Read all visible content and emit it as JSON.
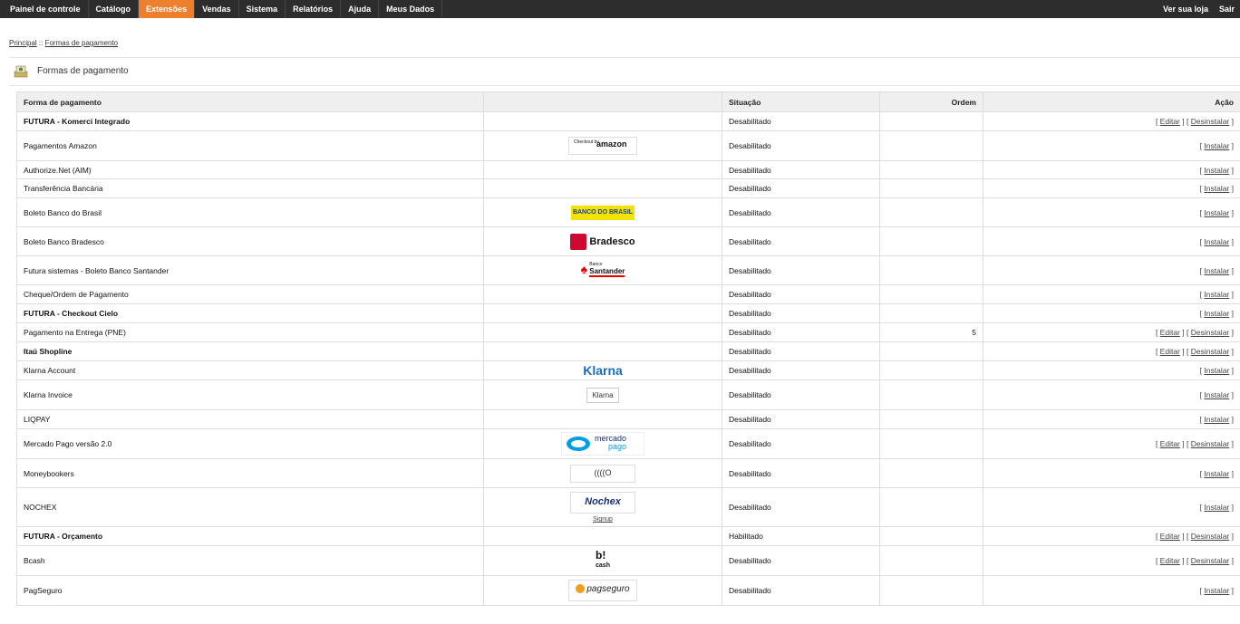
{
  "nav": {
    "items": [
      {
        "label": "Painel de controle",
        "active": false
      },
      {
        "label": "Catálogo",
        "active": false
      },
      {
        "label": "Extensões",
        "active": true
      },
      {
        "label": "Vendas",
        "active": false
      },
      {
        "label": "Sistema",
        "active": false
      },
      {
        "label": "Relatórios",
        "active": false
      },
      {
        "label": "Ajuda",
        "active": false
      },
      {
        "label": "Meus Dados",
        "active": false
      }
    ],
    "store_link": "Ver sua loja",
    "logout": "Sair"
  },
  "breadcrumb": {
    "home": "Principal",
    "separator": " :: ",
    "current": "Formas de pagamento"
  },
  "heading": {
    "title": "Formas de pagamento"
  },
  "table": {
    "headers": {
      "name": "Forma de pagamento",
      "logo": "",
      "status": "Situação",
      "order": "Ordem",
      "action": "Ação"
    },
    "edit_label": "Editar",
    "uninstall_label": "Desinstalar",
    "install_label": "Instalar",
    "rows": [
      {
        "name": "FUTURA - Komerci Integrado",
        "style": "bold",
        "logo": "",
        "status": "Desabilitado",
        "order": "",
        "actions": [
          "edit",
          "uninstall"
        ]
      },
      {
        "name": "Pagamentos Amazon",
        "style": "",
        "logo": "amazon",
        "status": "Desabilitado",
        "order": "",
        "actions": [
          "install"
        ]
      },
      {
        "name": "Authorize.Net (AIM)",
        "style": "",
        "logo": "",
        "status": "Desabilitado",
        "order": "",
        "actions": [
          "install"
        ]
      },
      {
        "name": "Transferência Bancária",
        "style": "",
        "logo": "",
        "status": "Desabilitado",
        "order": "",
        "actions": [
          "install"
        ]
      },
      {
        "name": "Boleto Banco do Brasil",
        "style": "",
        "logo": "bb",
        "status": "Desabilitado",
        "order": "",
        "actions": [
          "install"
        ]
      },
      {
        "name": "Boleto Banco Bradesco",
        "style": "",
        "logo": "bradesco",
        "status": "Desabilitado",
        "order": "",
        "actions": [
          "install"
        ]
      },
      {
        "name": "Futura sistemas - Boleto Banco Santander",
        "style": "",
        "logo": "santander",
        "status": "Desabilitado",
        "order": "",
        "actions": [
          "install"
        ]
      },
      {
        "name": "Cheque/Ordem de Pagamento",
        "style": "",
        "logo": "",
        "status": "Desabilitado",
        "order": "",
        "actions": [
          "install"
        ]
      },
      {
        "name": "FUTURA - Checkout Cielo",
        "style": "bold",
        "logo": "",
        "status": "Desabilitado",
        "order": "",
        "actions": [
          "install"
        ]
      },
      {
        "name": "Pagamento na Entrega (PNE)",
        "style": "",
        "logo": "",
        "status": "Desabilitado",
        "order": "5",
        "actions": [
          "edit",
          "uninstall"
        ]
      },
      {
        "name": "Itaú Shopline",
        "style": "blue",
        "logo": "",
        "status": "Desabilitado",
        "order": "",
        "actions": [
          "edit",
          "uninstall"
        ]
      },
      {
        "name": "Klarna Account",
        "style": "",
        "logo": "klarna",
        "status": "Desabilitado",
        "order": "",
        "actions": [
          "install"
        ]
      },
      {
        "name": "Klarna Invoice",
        "style": "",
        "logo": "klarna-broken",
        "status": "Desabilitado",
        "order": "",
        "actions": [
          "install"
        ]
      },
      {
        "name": "LIQPAY",
        "style": "",
        "logo": "",
        "status": "Desabilitado",
        "order": "",
        "actions": [
          "install"
        ]
      },
      {
        "name": "Mercado Pago versão 2.0",
        "style": "",
        "logo": "mercado",
        "status": "Desabilitado",
        "order": "",
        "actions": [
          "edit",
          "uninstall"
        ]
      },
      {
        "name": "Moneybookers",
        "style": "",
        "logo": "moneybookers",
        "status": "Desabilitado",
        "order": "",
        "actions": [
          "install"
        ]
      },
      {
        "name": "NOCHEX",
        "style": "",
        "logo": "nochex",
        "status": "Desabilitado",
        "order": "",
        "actions": [
          "install"
        ]
      },
      {
        "name": "FUTURA - Orçamento",
        "style": "bold",
        "logo": "",
        "status": "Habilitado",
        "order": "",
        "actions": [
          "edit",
          "uninstall"
        ]
      },
      {
        "name": "Bcash",
        "style": "",
        "logo": "bcash",
        "status": "Desabilitado",
        "order": "",
        "actions": [
          "edit",
          "uninstall"
        ]
      },
      {
        "name": "PagSeguro",
        "style": "",
        "logo": "pagseguro",
        "status": "Desabilitado",
        "order": "",
        "actions": [
          "install"
        ]
      }
    ]
  },
  "logos": {
    "amazon": {
      "small": "Checkout by",
      "big": "amazon"
    },
    "bb": {
      "text": "BANCO DO BRASIL"
    },
    "bradesco": {
      "text": "Bradesco"
    },
    "santander": {
      "small": "Banco",
      "big": "Santander"
    },
    "klarna": {
      "text": "Klarna"
    },
    "klarna_broken": {
      "text": "Klarna"
    },
    "mercado": {
      "line1": "mercado",
      "line2": "pago"
    },
    "moneybookers": {
      "text": "((((O"
    },
    "nochex": {
      "text": "Nochex",
      "sign": "Signup"
    },
    "bcash": {
      "line1": "b!",
      "line2": "cash"
    },
    "pagseguro": {
      "text": "pagseguro"
    }
  },
  "colors": {
    "nav_bg": "#2d2d2d",
    "nav_active": "#ee7f2c",
    "header_bg": "#efefef",
    "link_blue": "#1b3ea0"
  }
}
